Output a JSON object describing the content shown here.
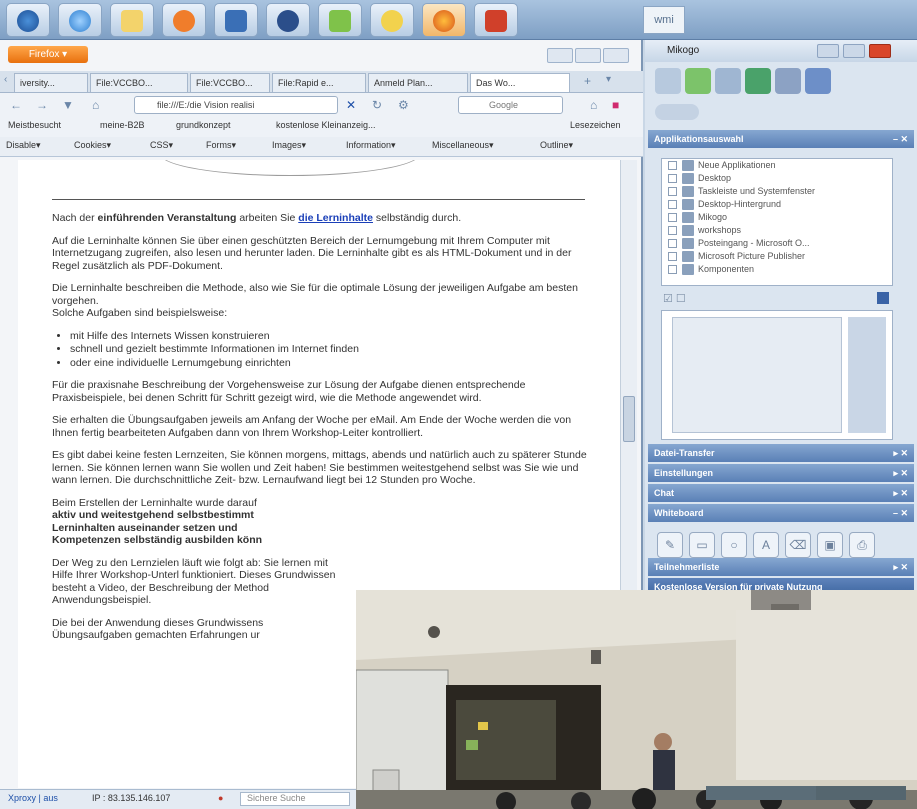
{
  "taskbar": {
    "wmi_label": "wmi"
  },
  "browser": {
    "menu_button": "Firefox ▾",
    "tabs": [
      "iversity...",
      "File:VCCBO...",
      "File:VCCBO...",
      "File:Rapid e...",
      "Anmeld Plan...",
      "Das Wo..."
    ],
    "tab_new": "+",
    "url": "file:///E:/die Vision realisi",
    "search_placeholder": "Google",
    "bookmarks": [
      "Meistbesucht",
      "meine-B2B",
      "grundkonzept",
      "kostenlose Kleinanzeig...",
      "Lesezeichen"
    ],
    "devbar": [
      "Disable▾",
      "Cookies▾",
      "CSS▾",
      "Forms▾",
      "Images▾",
      "Information▾",
      "Miscellaneous▾",
      "Outline▾"
    ]
  },
  "content": {
    "p1_pre": "Nach der",
    "p1_bold": "einführenden Veranstaltung",
    "p1_mid": "arbeiten Sie",
    "p1_link": "die Lerninhalte",
    "p1_post": "selbständig durch.",
    "p2": "Auf die Lerninhalte können Sie über einen geschützten Bereich der Lernumgebung mit Ihrem Computer mit Internetzugang zugreifen, also lesen und herunter laden. Die Lerninhalte gibt es als HTML-Dokument und in der Regel zusätzlich als PDF-Dokument.",
    "p3": "Die Lerninhalte beschreiben die Methode, also wie Sie für die optimale Lösung der jeweiligen Aufgabe am besten vorgehen.",
    "p3b": "Solche Aufgaben sind beispielsweise:",
    "list": [
      "mit Hilfe des Internets Wissen konstruieren",
      "schnell und gezielt bestimmte Informationen im Internet finden",
      "oder eine individuelle Lernumgebung einrichten"
    ],
    "p4": "Für die praxisnahe Beschreibung der Vorgehensweise zur Lösung der Aufgabe dienen entsprechende Praxisbeispiele, bei denen Schritt für Schritt gezeigt wird, wie die Methode angewendet wird.",
    "p5": "Sie erhalten die Übungsaufgaben jeweils am Anfang der Woche per eMail. Am Ende der Woche werden die von Ihnen fertig bearbeiteten Aufgaben dann von Ihrem Workshop-Leiter kontrolliert.",
    "p6": "Es gibt dabei keine festen Lernzeiten, Sie können morgens, mittags, abends und natürlich auch zu späterer Stunde lernen. Sie können lernen wann Sie wollen und Zeit haben! Sie bestimmen weitestgehend selbst was Sie wie und wann lernen. Die durchschnittliche Zeit- bzw. Lernaufwand liegt bei 12 Stunden pro Woche.",
    "p7_pre": "Beim Erstellen der Lerninhalte wurde darauf",
    "p7_b1": "aktiv und weitestgehend selbstbestimmt",
    "p7_b2": "Lerninhalten auseinander setzen und",
    "p7_b3": "Kompetenzen selbständig ausbilden könn",
    "p8": "Der Weg zu den Lernzielen läuft wie folgt ab: Sie lernen mit Hilfe Ihrer Workshop-Unterl funktioniert. Dieses Grundwissen besteht a Video, der Beschreibung der Method Anwendungsbeispiel.",
    "p9": "Die bei der Anwendung dieses Grundwissens Übungsaufgaben gemachten Erfahrungen ur"
  },
  "statusbar": {
    "proxy": "Xproxy | aus",
    "ip": "IP : 83.135.146.107",
    "search_placeholder": "Sichere Suche"
  },
  "sidebar": {
    "title": "Mikogo",
    "sections": {
      "apps": "Applikationsauswahl",
      "file": "Datei-Transfer",
      "settings": "Einstellungen",
      "chat": "Chat",
      "whiteboard": "Whiteboard",
      "participants": "Teilnehmerliste",
      "promo": "Kostenlose Version für private Nutzung"
    },
    "apps": [
      "Neue Applikationen",
      "Desktop",
      "Taskleiste und Systemfenster",
      "Desktop-Hintergrund",
      "Mikogo",
      "workshops",
      "Posteingang - Microsoft O...",
      "Microsoft Picture Publisher",
      "Komponenten"
    ]
  },
  "colors": {
    "accent": "#5a80b6",
    "firefox": "#e8700e"
  }
}
